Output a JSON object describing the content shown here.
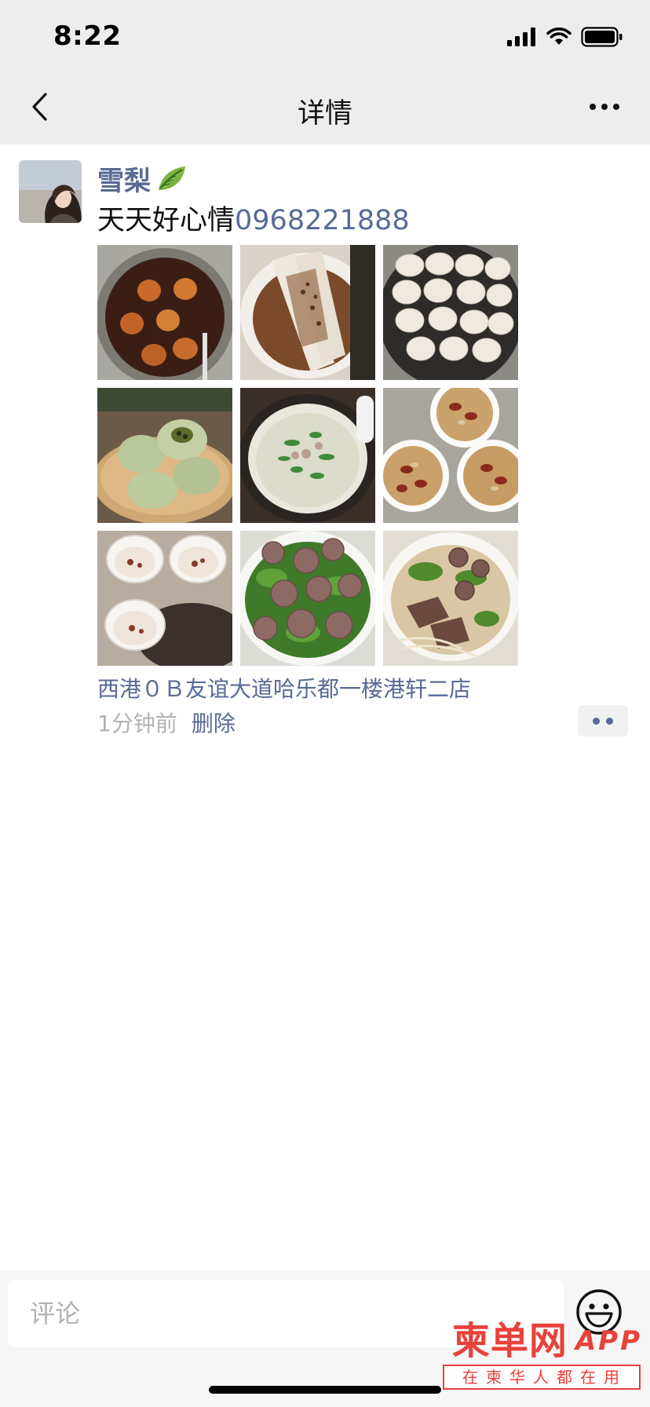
{
  "status_bar": {
    "time": "8:22"
  },
  "nav": {
    "title": "详情"
  },
  "post": {
    "author": "雪梨",
    "content_text": "天天好心情",
    "content_phone": "0968221888",
    "photos": [
      {
        "name": "photo-braised-eggs"
      },
      {
        "name": "photo-rice-noodle-rolls"
      },
      {
        "name": "photo-wontons"
      },
      {
        "name": "photo-steamed-buns"
      },
      {
        "name": "photo-congee"
      },
      {
        "name": "photo-date-soup"
      },
      {
        "name": "photo-dessert-cups"
      },
      {
        "name": "photo-meatball-soup"
      },
      {
        "name": "photo-beef-noodles"
      }
    ],
    "location": "西港０Ｂ友谊大道哈乐都一楼港轩二店",
    "time_ago": "1分钟前",
    "delete_label": "删除"
  },
  "comment_bar": {
    "placeholder": "评论"
  },
  "watermark": {
    "brand": "柬单网",
    "app": "APP",
    "slogan": "在柬华人都在用"
  },
  "colors": {
    "link": "#576b95",
    "nav_bg": "#ededed",
    "accent": "#e8423a"
  }
}
